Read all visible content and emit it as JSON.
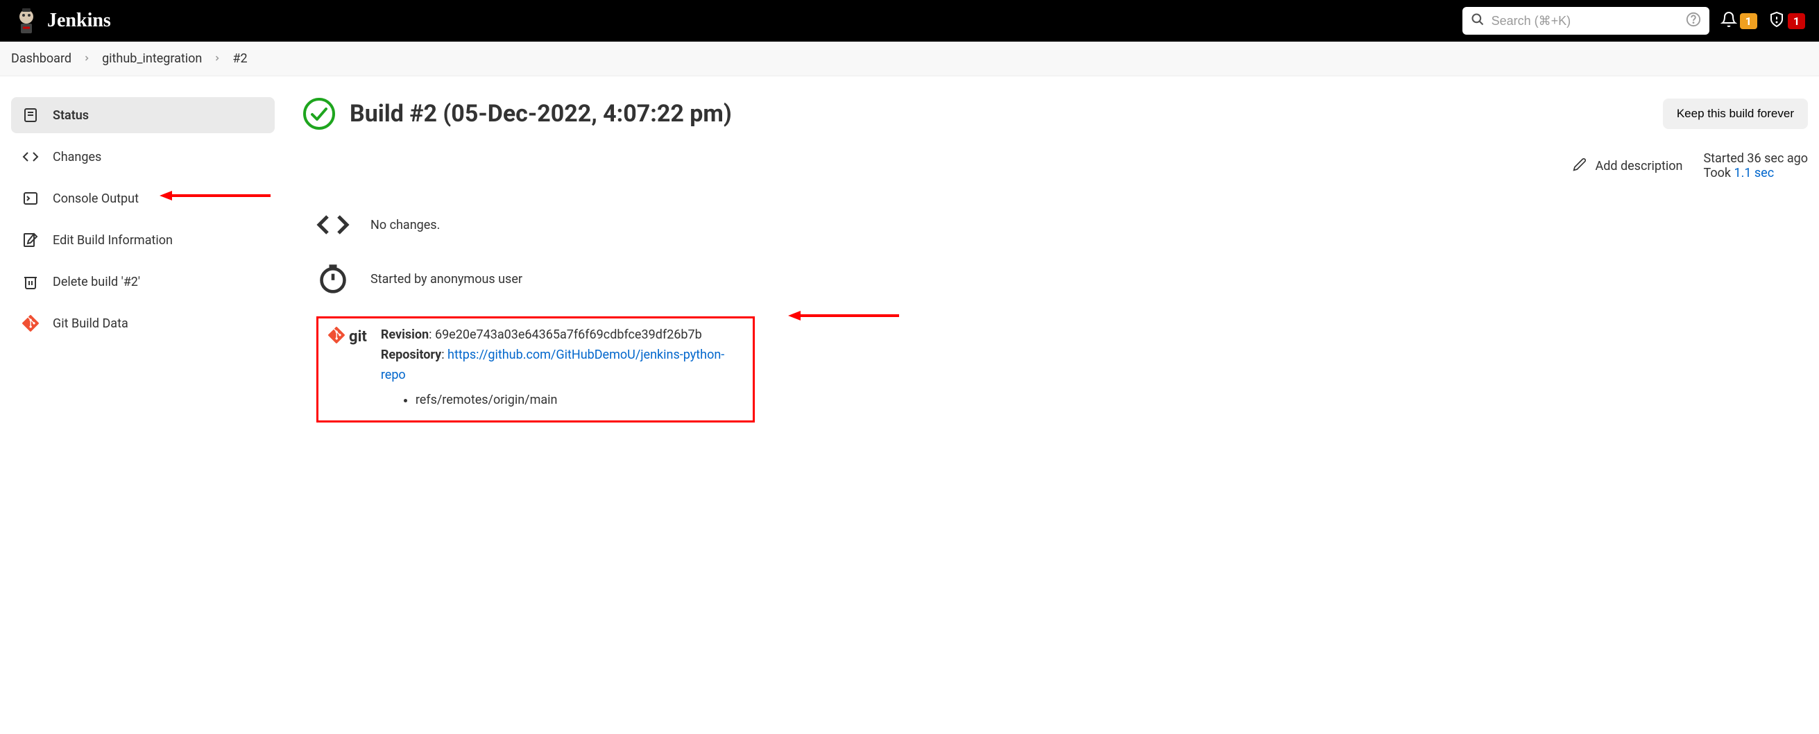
{
  "header": {
    "app_name": "Jenkins",
    "search_placeholder": "Search (⌘+K)",
    "notification_count": "1",
    "alert_count": "1"
  },
  "breadcrumbs": {
    "items": [
      "Dashboard",
      "github_integration",
      "#2"
    ]
  },
  "sidebar": {
    "items": [
      {
        "label": "Status"
      },
      {
        "label": "Changes"
      },
      {
        "label": "Console Output"
      },
      {
        "label": "Edit Build Information"
      },
      {
        "label": "Delete build '#2'"
      },
      {
        "label": "Git Build Data"
      }
    ]
  },
  "main": {
    "title": "Build #2 (05-Dec-2022, 4:07:22 pm)",
    "keep_button": "Keep this build forever",
    "add_description": "Add description",
    "started_text": "Started 36 sec ago",
    "took_prefix": "Took ",
    "took_duration": "1.1 sec",
    "no_changes": "No changes.",
    "started_by": "Started by anonymous user",
    "git": {
      "revision_label": "Revision",
      "revision_value": "69e20e743a03e64365a7f6f69cdbfce39df26b7b",
      "repository_label": "Repository",
      "repository_url": "https://github.com/GitHubDemoU/jenkins-python-repo",
      "ref": "refs/remotes/origin/main",
      "logo_text": "git"
    }
  }
}
